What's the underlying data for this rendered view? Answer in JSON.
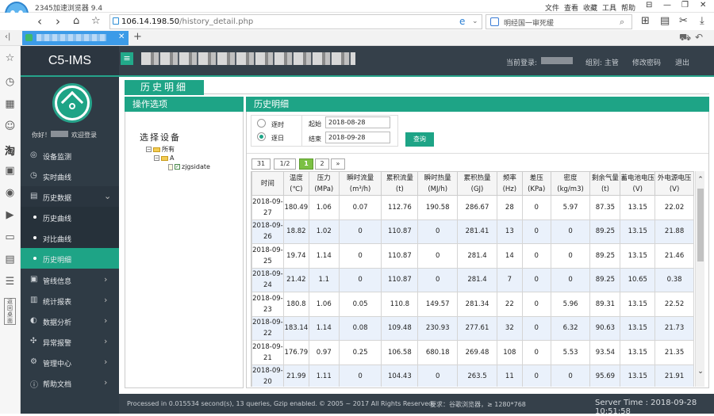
{
  "browser": {
    "app_title": "2345加速浏览器 9.4",
    "menu": [
      "文件",
      "查看",
      "收藏",
      "工具",
      "帮助"
    ],
    "url_host": "106.14.198.50",
    "url_path": "/history_detail.php",
    "search_text": "明经国一审死缓",
    "nav_icons": [
      "back-icon",
      "forward-icon",
      "home-icon",
      "star-icon"
    ]
  },
  "header": {
    "brand": "C5-IMS",
    "menu_toggle": "≡",
    "current_login": "当前登录:",
    "group": "组别: 主管",
    "change_password": "修改密码",
    "logout": "退出"
  },
  "user": {
    "greeting": "你好！",
    "welcome": "欢迎登录"
  },
  "sidebar": {
    "items": [
      {
        "label": "设备监测",
        "icon": "◎"
      },
      {
        "label": "实时曲线",
        "icon": "◷"
      },
      {
        "label": "历史数据",
        "icon": "▤",
        "arrow": "⌄"
      },
      {
        "label": "管线信息",
        "icon": "▣",
        "arrow": "›"
      },
      {
        "label": "统计报表",
        "icon": "▥",
        "arrow": "›"
      },
      {
        "label": "数据分析",
        "icon": "◐",
        "arrow": "›"
      },
      {
        "label": "异常报警",
        "icon": "✣",
        "arrow": "›"
      },
      {
        "label": "管理中心",
        "icon": "⚙",
        "arrow": "›"
      },
      {
        "label": "帮助文档",
        "icon": "ⓘ",
        "arrow": "›"
      }
    ],
    "subitems": [
      {
        "label": "历史曲线"
      },
      {
        "label": "对比曲线"
      },
      {
        "label": "历史明细"
      }
    ]
  },
  "page": {
    "title": "历史明细",
    "left_panel_title": "操作选项",
    "right_panel_title": "历史明细",
    "device_select_title": "选择设备",
    "tree": {
      "root": "所有",
      "child": "A",
      "leaf": "zjgsidate"
    }
  },
  "options": {
    "by_hour": "逐时",
    "by_day": "逐日",
    "start_label": "起始",
    "end_label": "结束",
    "start_value": "2018-08-28",
    "end_value": "2018-09-28",
    "query_button": "查询"
  },
  "pagination": {
    "total": "31",
    "pages": "1/2",
    "p1": "1",
    "p2": "2",
    "next": "»"
  },
  "table": {
    "headers": [
      {
        "l1": "时间",
        "l2": ""
      },
      {
        "l1": "温度",
        "l2": "(℃)"
      },
      {
        "l1": "压力",
        "l2": "(MPa)"
      },
      {
        "l1": "瞬时流量",
        "l2": "(m³/h)"
      },
      {
        "l1": "累积流量",
        "l2": "(t)"
      },
      {
        "l1": "瞬时热量",
        "l2": "(MJ/h)"
      },
      {
        "l1": "累积热量",
        "l2": "(GJ)"
      },
      {
        "l1": "频率",
        "l2": "(Hz)"
      },
      {
        "l1": "差压",
        "l2": "(KPa)"
      },
      {
        "l1": "密度",
        "l2": "(kg/m3)"
      },
      {
        "l1": "剩余气量",
        "l2": "(t)"
      },
      {
        "l1": "蓄电池电压",
        "l2": "(V)"
      },
      {
        "l1": "外电源电压",
        "l2": "(V)"
      }
    ],
    "rows": [
      {
        "d1": "2018-09-",
        "d2": "27",
        "v": [
          "180.49",
          "1.06",
          "0.07",
          "112.76",
          "190.58",
          "286.67",
          "28",
          "0",
          "5.97",
          "87.35",
          "13.15",
          "22.02"
        ]
      },
      {
        "d1": "2018-09-",
        "d2": "26",
        "v": [
          "18.82",
          "1.02",
          "0",
          "110.87",
          "0",
          "281.41",
          "13",
          "0",
          "0",
          "89.25",
          "13.15",
          "21.88"
        ]
      },
      {
        "d1": "2018-09-",
        "d2": "25",
        "v": [
          "19.74",
          "1.14",
          "0",
          "110.87",
          "0",
          "281.4",
          "14",
          "0",
          "0",
          "89.25",
          "13.15",
          "21.46"
        ]
      },
      {
        "d1": "2018-09-",
        "d2": "24",
        "v": [
          "21.42",
          "1.1",
          "0",
          "110.87",
          "0",
          "281.4",
          "7",
          "0",
          "0",
          "89.25",
          "10.65",
          "0.38"
        ]
      },
      {
        "d1": "2018-09-",
        "d2": "23",
        "v": [
          "180.8",
          "1.06",
          "0.05",
          "110.8",
          "149.57",
          "281.34",
          "22",
          "0",
          "5.96",
          "89.31",
          "13.15",
          "22.52"
        ]
      },
      {
        "d1": "2018-09-",
        "d2": "22",
        "v": [
          "183.14",
          "1.14",
          "0.08",
          "109.48",
          "230.93",
          "277.61",
          "32",
          "0",
          "6.32",
          "90.63",
          "13.15",
          "21.73"
        ]
      },
      {
        "d1": "2018-09-",
        "d2": "21",
        "v": [
          "176.79",
          "0.97",
          "0.25",
          "106.58",
          "680.18",
          "269.48",
          "108",
          "0",
          "5.53",
          "93.54",
          "13.15",
          "21.35"
        ]
      },
      {
        "d1": "2018-09-",
        "d2": "20",
        "v": [
          "21.99",
          "1.11",
          "0",
          "104.43",
          "0",
          "263.5",
          "11",
          "0",
          "0",
          "95.69",
          "13.15",
          "21.91"
        ]
      }
    ]
  },
  "footer": {
    "processed": "Processed in 0.015534 second(s), 13 queries, Gzip enabled.",
    "copyright": "© 2005 ~ 2017 All Rights Reserved.",
    "requirement": "要求：谷歌浏览器，≥ 1280*768",
    "server_time": "Server Time : 2018-09-28 10:51:58"
  }
}
